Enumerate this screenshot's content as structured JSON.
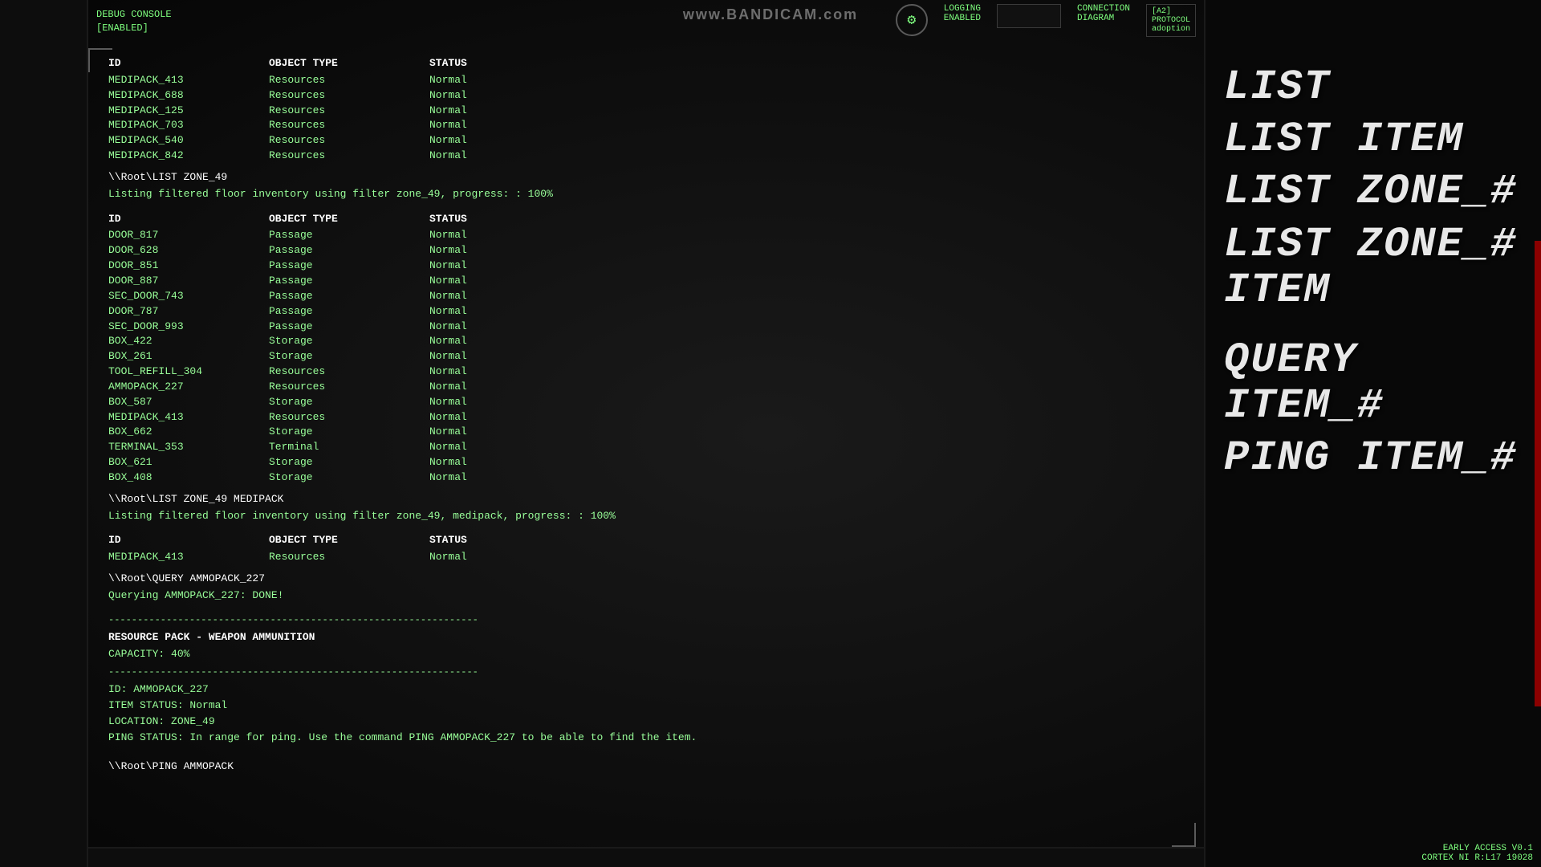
{
  "watermark": {
    "text": "www.",
    "brand": "BANDICAM",
    "suffix": ".com"
  },
  "debug_console": {
    "label": "DEBUG CONSOLE",
    "status": "[ENABLED]"
  },
  "top_right": {
    "logging_label": "LOGGING",
    "logging_status": "ENABLED",
    "connection_label": "CONNECTION",
    "connection_sub": "DIAGRAM",
    "protocol_label": "[A2]",
    "protocol_sub": "PROTOCOL",
    "protocol_detail": "adoption"
  },
  "table1": {
    "headers": [
      "ID",
      "OBJECT TYPE",
      "STATUS"
    ],
    "rows": [
      {
        "id": "MEDIPACK_413",
        "type": "Resources",
        "status": "Normal"
      },
      {
        "id": "MEDIPACK_688",
        "type": "Resources",
        "status": "Normal"
      },
      {
        "id": "MEDIPACK_125",
        "type": "Resources",
        "status": "Normal"
      },
      {
        "id": "MEDIPACK_703",
        "type": "Resources",
        "status": "Normal"
      },
      {
        "id": "MEDIPACK_540",
        "type": "Resources",
        "status": "Normal"
      },
      {
        "id": "MEDIPACK_842",
        "type": "Resources",
        "status": "Normal"
      }
    ]
  },
  "command1": {
    "prompt": "\\\\Root\\LIST ZONE_49",
    "result": "Listing filtered floor inventory using filter zone_49, progress: : 100%"
  },
  "table2": {
    "headers": [
      "ID",
      "OBJECT TYPE",
      "STATUS"
    ],
    "rows": [
      {
        "id": "DOOR_817",
        "type": "Passage",
        "status": "Normal"
      },
      {
        "id": "DOOR_628",
        "type": "Passage",
        "status": "Normal"
      },
      {
        "id": "DOOR_851",
        "type": "Passage",
        "status": "Normal"
      },
      {
        "id": "DOOR_887",
        "type": "Passage",
        "status": "Normal"
      },
      {
        "id": "SEC_DOOR_743",
        "type": "Passage",
        "status": "Normal"
      },
      {
        "id": "DOOR_787",
        "type": "Passage",
        "status": "Normal"
      },
      {
        "id": "SEC_DOOR_993",
        "type": "Passage",
        "status": "Normal"
      },
      {
        "id": "BOX_422",
        "type": "Storage",
        "status": "Normal"
      },
      {
        "id": "BOX_261",
        "type": "Storage",
        "status": "Normal"
      },
      {
        "id": "TOOL_REFILL_304",
        "type": "Resources",
        "status": "Normal"
      },
      {
        "id": "AMMOPACK_227",
        "type": "Resources",
        "status": "Normal"
      },
      {
        "id": "BOX_587",
        "type": "Storage",
        "status": "Normal"
      },
      {
        "id": "MEDIPACK_413",
        "type": "Resources",
        "status": "Normal"
      },
      {
        "id": "BOX_662",
        "type": "Storage",
        "status": "Normal"
      },
      {
        "id": "TERMINAL_353",
        "type": "Terminal",
        "status": "Normal"
      },
      {
        "id": "BOX_621",
        "type": "Storage",
        "status": "Normal"
      },
      {
        "id": "BOX_408",
        "type": "Storage",
        "status": "Normal"
      }
    ]
  },
  "command2": {
    "prompt": "\\\\Root\\LIST ZONE_49 MEDIPACK",
    "result": "Listing filtered floor inventory using filter zone_49, medipack, progress: : 100%"
  },
  "table3": {
    "headers": [
      "ID",
      "OBJECT TYPE",
      "STATUS"
    ],
    "rows": [
      {
        "id": "MEDIPACK_413",
        "type": "Resources",
        "status": "Normal"
      }
    ]
  },
  "command3": {
    "prompt": "\\\\Root\\QUERY AMMOPACK_227",
    "result": "Querying AMMOPACK_227: DONE!"
  },
  "divider": "----------------------------------------------------------------",
  "query_result": {
    "section1_title": "RESOURCE PACK - WEAPON AMMUNITION",
    "section1_detail": "CAPACITY: 40%",
    "section2_details": [
      "ID: AMMOPACK_227",
      "ITEM STATUS: Normal",
      "LOCATION: ZONE_49",
      "PING STATUS: In range for ping. Use the command PING AMMOPACK_227 to be able to find the item."
    ]
  },
  "command4": {
    "prompt": "\\\\Root\\PING AMMOPACK"
  },
  "commands_help": {
    "list": "LIST",
    "list_item": "LIST ITEM",
    "list_zone": "LIST ZONE_#",
    "list_zone_item": "LIST ZONE_# ITEM",
    "query_item": "QUERY ITEM_#",
    "ping_item": "PING ITEM_#"
  },
  "version": {
    "line1": "EARLY ACCESS V0.1",
    "line2": "CORTEX NI R:L17 19028"
  }
}
